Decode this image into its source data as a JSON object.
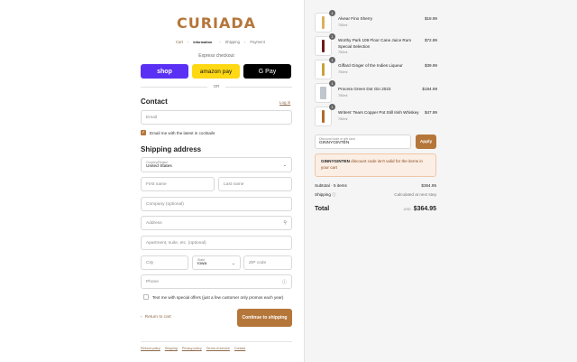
{
  "brand": {
    "logo_text": "CURIADA",
    "accent": "#b5763a"
  },
  "breadcrumb": {
    "items": [
      "Cart",
      "Information",
      "Shipping",
      "Payment"
    ],
    "current": "Information"
  },
  "express": {
    "label": "Express checkout",
    "shop": "shop",
    "amazon": "amazon pay",
    "gpay": "G Pay",
    "or": "OR"
  },
  "contact": {
    "title": "Contact",
    "login": "Log in",
    "email_placeholder": "Email",
    "newsletter_label": "Email me with the latest in cocktails"
  },
  "shipping": {
    "title": "Shipping address",
    "country_label": "Country/Region",
    "country_value": "United States",
    "first_name": "First name",
    "last_name": "Last name",
    "company": "Company (optional)",
    "address": "Address",
    "apartment": "Apartment, suite, etc. (optional)",
    "city": "City",
    "state_label": "State",
    "state_value": "Iowa",
    "zip": "ZIP code",
    "phone": "Phone",
    "sms_label": "Text me with special offers (just a few customer only promos each year)"
  },
  "actions": {
    "return": "Return to cart",
    "continue": "Continue to shipping"
  },
  "footer": {
    "links": [
      "Refund policy",
      "Shipping",
      "Privacy policy",
      "Terms of service",
      "Contact"
    ]
  },
  "cart": {
    "items": [
      {
        "qty": "1",
        "name": "Alvear Fino Sherry",
        "variant": "750ml",
        "price": "$18.99",
        "color": "#d9b25a"
      },
      {
        "qty": "1",
        "name": "Worthy Park 109 Floor Cane Juice Rum Special Selection",
        "variant": "750ml",
        "price": "$72.99",
        "color": "#6b1d1d"
      },
      {
        "qty": "1",
        "name": "Giffard Ginger of the Indies Liqueur",
        "variant": "750ml",
        "price": "$39.99",
        "color": "#c9a03c"
      },
      {
        "qty": "1",
        "name": "Procera Green Dot Gin 2023",
        "variant": "750ml",
        "price": "$184.99",
        "color": "#bfc6cc"
      },
      {
        "qty": "1",
        "name": "Writers' Tears Copper Pot Still Irish Whiskey",
        "variant": "750ml",
        "price": "$47.99",
        "color": "#b06a2a"
      }
    ],
    "discount_label": "Discount code or gift card",
    "discount_value": "GINNYGINTEN",
    "apply": "Apply",
    "error_code": "GINNYGINTEN",
    "error_text": " discount code isn't valid for the items in your cart",
    "subtotal_label": "Subtotal · 5 items",
    "subtotal_value": "$364.95",
    "shipping_label": "Shipping",
    "shipping_value": "Calculated at next step",
    "total_label": "Total",
    "currency": "USD",
    "total_value": "$364.95"
  }
}
